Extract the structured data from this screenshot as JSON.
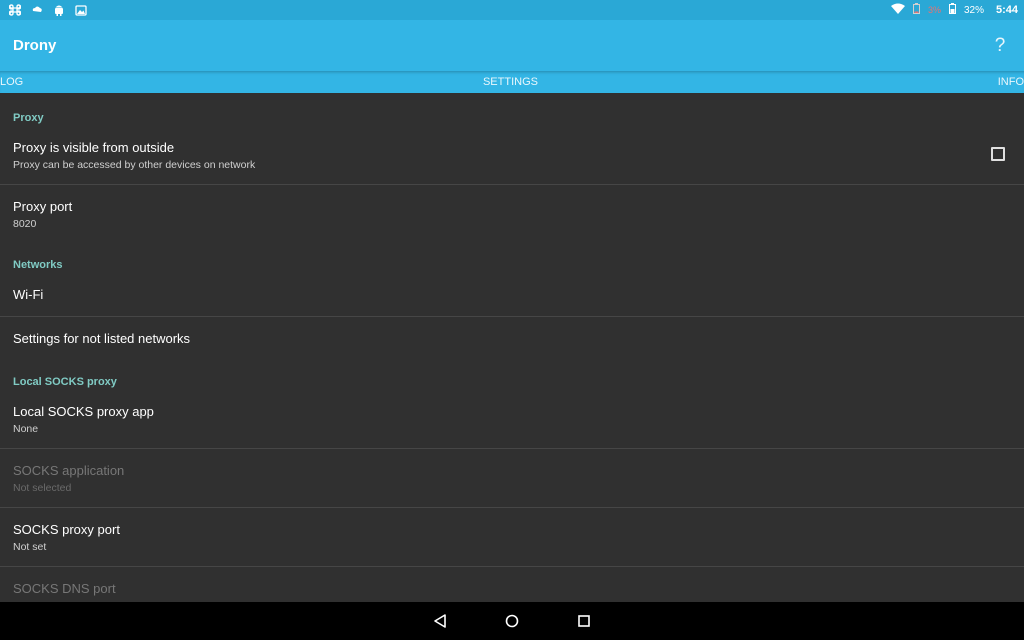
{
  "status_bar": {
    "left_icons": [
      "command-icon",
      "cloud-icon",
      "android-icon",
      "photo-icon"
    ],
    "battery_low_text": "3%",
    "battery_text": "32%",
    "time": "5:44"
  },
  "app_bar": {
    "title": "Drony",
    "help_label": "?"
  },
  "tabs": {
    "left": "LOG",
    "center": "SETTINGS",
    "right": "INFO"
  },
  "settings": {
    "categories": {
      "proxy": "Proxy",
      "networks": "Networks",
      "local_socks": "Local SOCKS proxy"
    },
    "items": {
      "proxy_visible": {
        "title": "Proxy is visible from outside",
        "summary": "Proxy can be accessed by other devices on network",
        "checked": false
      },
      "proxy_port": {
        "title": "Proxy port",
        "summary": "8020"
      },
      "wifi": {
        "title": "Wi-Fi"
      },
      "not_listed": {
        "title": "Settings for not listed networks"
      },
      "socks_app": {
        "title": "Local SOCKS proxy app",
        "summary": "None"
      },
      "socks_application": {
        "title": "SOCKS application",
        "summary": "Not selected",
        "disabled": true
      },
      "socks_port": {
        "title": "SOCKS proxy port",
        "summary": "Not set"
      },
      "socks_dns_port": {
        "title": "SOCKS DNS port",
        "disabled": true
      }
    }
  },
  "colors": {
    "status_bar": "#2aa8d6",
    "app_bar": "#33b5e5",
    "category_text": "#80cbc4",
    "background": "#303030"
  }
}
